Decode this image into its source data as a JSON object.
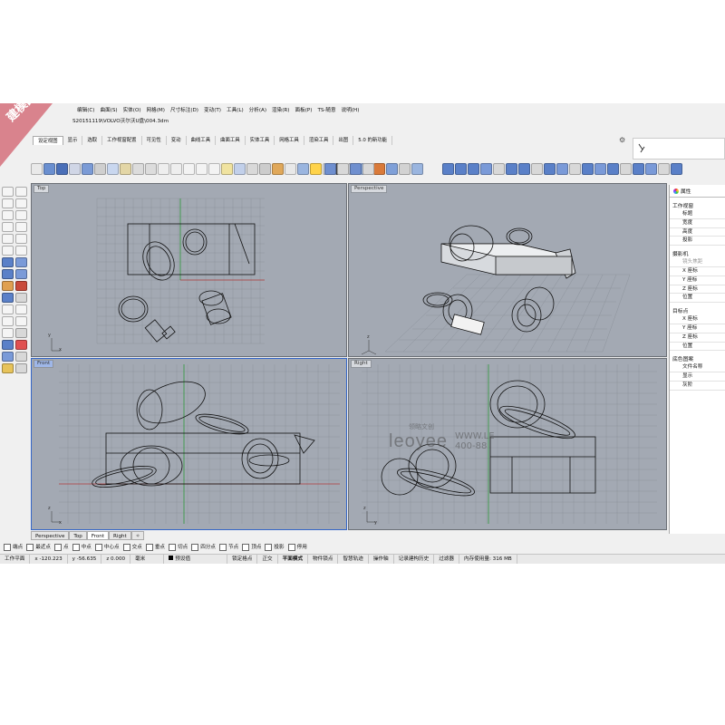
{
  "badge": "建模图",
  "menubar": [
    "编辑(C)",
    "曲面(S)",
    "实体(O)",
    "网格(M)",
    "尺寸标注(D)",
    "变动(T)",
    "工具(L)",
    "分析(A)",
    "渲染(R)",
    "面板(P)",
    "TS-随意",
    "说明(H)"
  ],
  "file_path": "S20151119\\VOLVO沃尔沃U盘\\004.3dm",
  "tabs": [
    "设定视图",
    "显示",
    "选取",
    "工作视窗配置",
    "可见性",
    "变动",
    "曲线工具",
    "曲面工具",
    "实体工具",
    "网格工具",
    "渲染工具",
    "出图",
    "5.0 的新功能"
  ],
  "viewports": {
    "top": "Top",
    "perspective": "Perspective",
    "front": "Front",
    "right": "Right"
  },
  "viewport_tabs": [
    "Perspective",
    "Top",
    "Front",
    "Right"
  ],
  "osnaps": [
    {
      "label": "端点",
      "on": false
    },
    {
      "label": "最近点",
      "on": false
    },
    {
      "label": "点",
      "on": false
    },
    {
      "label": "中点",
      "on": false
    },
    {
      "label": "中心点",
      "on": false
    },
    {
      "label": "交点",
      "on": false
    },
    {
      "label": "垂点",
      "on": false
    },
    {
      "label": "切点",
      "on": false
    },
    {
      "label": "四分点",
      "on": false
    },
    {
      "label": "节点",
      "on": false
    },
    {
      "label": "顶点",
      "on": false
    },
    {
      "label": "投影",
      "on": false
    },
    {
      "label": "停用",
      "on": false
    }
  ],
  "status": {
    "cplane": "工作平面",
    "x": "x -120.223",
    "y": "y -56.635",
    "z": "z 0.000",
    "unit": "毫米",
    "layer": "预设值",
    "grid_snap": "锁定格点",
    "ortho": "正交",
    "planar": "平面模式",
    "osnap": "物件锁点",
    "smarttrack": "智慧轨迹",
    "gumball": "操作轴",
    "history": "记录建构历史",
    "filter": "过滤器",
    "memory": "内存使用量: 316 MB"
  },
  "properties": {
    "tab": "属性",
    "section_viewport": "工作视窗",
    "rows_viewport": [
      "标题",
      "宽度",
      "高度",
      "投影"
    ],
    "section_camera": "摄影机",
    "rows_camera": [
      "镜头焦距",
      "X 座标",
      "Y 座标",
      "Z 座标",
      "位置"
    ],
    "section_target": "目标点",
    "rows_target": [
      "X 座标",
      "Y 座标",
      "Z 座标",
      "位置"
    ],
    "section_wallpaper": "底色图案",
    "rows_wallpaper": [
      "文件名称",
      "显示",
      "灰阶"
    ]
  },
  "watermark": {
    "brand_cn": "领略文创",
    "brand": "leoyee",
    "url": "WWW.LE",
    "phone": "400-88"
  },
  "colors": {
    "viewport_bg": "#a3a9b3",
    "grid_line": "#8d939c",
    "x_axis": "#b13a3a",
    "y_axis": "#2f9a3a",
    "active_border": "#3466c8",
    "badge": "#d9838d"
  }
}
